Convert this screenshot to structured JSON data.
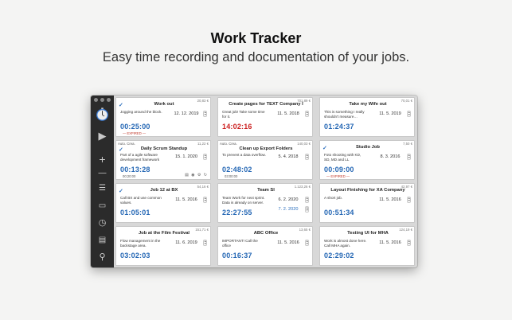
{
  "hero": {
    "title": "Work Tracker",
    "subtitle": "Easy time recording and documentation of your jobs."
  },
  "colors": {
    "accent_blue": "#2366b4",
    "alert_red": "#cc1f1f",
    "sidebar_bg": "#2b2b2b"
  },
  "sidebar": {
    "items": [
      {
        "icon": "stopwatch-icon"
      },
      {
        "icon": "play-icon",
        "glyph": "▶"
      },
      {
        "icon": "plus-icon",
        "glyph": "+"
      },
      {
        "icon": "minus-icon",
        "glyph": "—"
      },
      {
        "icon": "list-icon",
        "glyph": "☰"
      },
      {
        "icon": "book-icon",
        "glyph": "▭"
      },
      {
        "icon": "clock-icon",
        "glyph": "◷"
      },
      {
        "icon": "document-icon",
        "glyph": "▤"
      },
      {
        "icon": "search-icon",
        "glyph": "⚲"
      }
    ]
  },
  "cards": [
    {
      "title": "Work out",
      "price": "20,83 €",
      "auto": "",
      "checked": true,
      "desc": "Jogging around the block.",
      "date": "12. 12. 2019",
      "date2": "",
      "time": "00:25:00",
      "time_color": "blue",
      "sub": "— EXPIRED —",
      "sub_red": true,
      "tools": ""
    },
    {
      "title": "Create pages for TEXT Company I",
      "price": "701,89 €",
      "auto": "",
      "checked": false,
      "desc": "Great job! Take some time for it.",
      "date": "11. 5. 2018",
      "date2": "",
      "time": "14:02:16",
      "time_color": "red",
      "sub": "",
      "sub_red": false,
      "tools": ""
    },
    {
      "title": "Take my Wife out",
      "price": "70,01 €",
      "auto": "",
      "checked": false,
      "desc": "This is something I really shouldn't measure…",
      "date": "11. 5. 2019",
      "date2": "",
      "time": "01:24:37",
      "time_color": "blue",
      "sub": "",
      "sub_red": false,
      "tools": ""
    },
    {
      "title": "Daily Scrum Standup",
      "price": "11,22 €",
      "auto": "Auto. Crea.",
      "checked": true,
      "desc": "Part of a agile software development framework",
      "date": "15. 1. 2020",
      "date2": "",
      "time": "00:13:28",
      "time_color": "blue",
      "sub": "00:20:00",
      "sub_red": false,
      "tools": "▤ ◉ ⚙ ↻"
    },
    {
      "title": "Clean up Export Folders",
      "price": "140,03 €",
      "auto": "Auto. Crea.",
      "checked": false,
      "desc": "To prevent a data overflow.",
      "date": "5. 4. 2018",
      "date2": "",
      "time": "02:48:02",
      "time_color": "blue",
      "sub": "03:00:00",
      "sub_red": false,
      "tools": ""
    },
    {
      "title": "Studio Job",
      "price": "7,50 €",
      "auto": "",
      "checked": true,
      "desc": "Foto shooting with KD, SD, MD and LL",
      "date": "8. 3. 2016",
      "date2": "",
      "time": "00:09:00",
      "time_color": "blue",
      "sub": "— EXPIRED —",
      "sub_red": true,
      "tools": ""
    },
    {
      "title": "Job 12 at BX",
      "price": "54,16 €",
      "auto": "",
      "checked": true,
      "desc": "Call BX and use common values.",
      "date": "11. 5. 2016",
      "date2": "",
      "time": "01:05:01",
      "time_color": "blue",
      "sub": "",
      "sub_red": false,
      "tools": ""
    },
    {
      "title": "Team SI",
      "price": "1.123,26 €",
      "auto": "",
      "checked": false,
      "desc": "Team Work for next sprint. Data is already on server.",
      "date": "6. 2. 2020",
      "date2": "7. 2. 2020",
      "time": "22:27:55",
      "time_color": "blue",
      "sub": "",
      "sub_red": false,
      "tools": ""
    },
    {
      "title": "Layout Finishing for XA Company",
      "price": "42,97 €",
      "auto": "",
      "checked": false,
      "desc": "A short job.",
      "date": "11. 5. 2016",
      "date2": "",
      "time": "00:51:34",
      "time_color": "blue",
      "sub": "",
      "sub_red": false,
      "tools": ""
    },
    {
      "title": "Job at the Film Festival",
      "price": "151,71 €",
      "auto": "",
      "checked": false,
      "desc": "Flow management in the backstage area.",
      "date": "11. 6. 2019",
      "date2": "",
      "time": "03:02:03",
      "time_color": "blue",
      "sub": "",
      "sub_red": false,
      "tools": ""
    },
    {
      "title": "ABC Office",
      "price": "13,65 €",
      "auto": "",
      "checked": false,
      "desc": "IMPORTANT! Call the office",
      "date": "11. 5. 2016",
      "date2": "",
      "time": "00:16:37",
      "time_color": "blue",
      "sub": "",
      "sub_red": false,
      "tools": ""
    },
    {
      "title": "Testing UI for MHA",
      "price": "124,19 €",
      "auto": "",
      "checked": false,
      "desc": "Work is almost done here. Call MHA again.",
      "date": "11. 5. 2016",
      "date2": "",
      "time": "02:29:02",
      "time_color": "blue",
      "sub": "",
      "sub_red": false,
      "tools": ""
    }
  ]
}
